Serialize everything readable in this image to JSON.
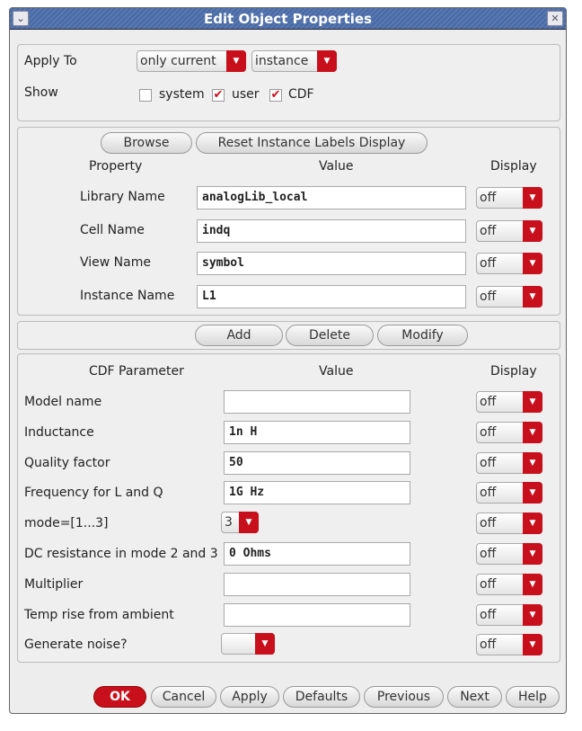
{
  "window": {
    "title": "Edit Object Properties",
    "menu_icon": "chevron-down-icon",
    "close_icon": "close-icon"
  },
  "apply": {
    "label": "Apply To",
    "scope": "only current",
    "type": "instance",
    "show_label": "Show",
    "checks": [
      {
        "label": "system",
        "checked": false
      },
      {
        "label": "user",
        "checked": true
      },
      {
        "label": "CDF",
        "checked": true
      }
    ]
  },
  "props": {
    "browse": "Browse",
    "reset": "Reset Instance Labels Display",
    "col_property": "Property",
    "col_value": "Value",
    "col_display": "Display",
    "rows": [
      {
        "label": "Library Name",
        "value": "analogLib_local",
        "display": "off"
      },
      {
        "label": "Cell Name",
        "value": "indq",
        "display": "off"
      },
      {
        "label": "View Name",
        "value": "symbol",
        "display": "off"
      },
      {
        "label": "Instance Name",
        "value": "L1",
        "display": "off"
      }
    ]
  },
  "actions": {
    "add": "Add",
    "delete": "Delete",
    "modify": "Modify"
  },
  "cdf": {
    "col_param": "CDF Parameter",
    "col_value": "Value",
    "col_display": "Display",
    "rows": [
      {
        "label": "Model name",
        "value": "",
        "display": "off",
        "kind": "input"
      },
      {
        "label": "Inductance",
        "value": "1n H",
        "display": "off",
        "kind": "input"
      },
      {
        "label": "Quality factor",
        "value": "50",
        "display": "off",
        "kind": "input"
      },
      {
        "label": "Frequency for L and Q",
        "value": "1G Hz",
        "display": "off",
        "kind": "input"
      },
      {
        "label": "mode=[1...3]",
        "value": "3",
        "display": "off",
        "kind": "combo"
      },
      {
        "label": "DC resistance in mode 2 and 3",
        "value": "0 Ohms",
        "display": "off",
        "kind": "input"
      },
      {
        "label": "Multiplier",
        "value": "",
        "display": "off",
        "kind": "input"
      },
      {
        "label": "Temp rise from ambient",
        "value": "",
        "display": "off",
        "kind": "input"
      },
      {
        "label": "Generate noise?",
        "value": "",
        "display": "off",
        "kind": "combo"
      }
    ]
  },
  "footer": {
    "ok": "OK",
    "cancel": "Cancel",
    "apply": "Apply",
    "defaults": "Defaults",
    "previous": "Previous",
    "next": "Next",
    "help": "Help"
  }
}
